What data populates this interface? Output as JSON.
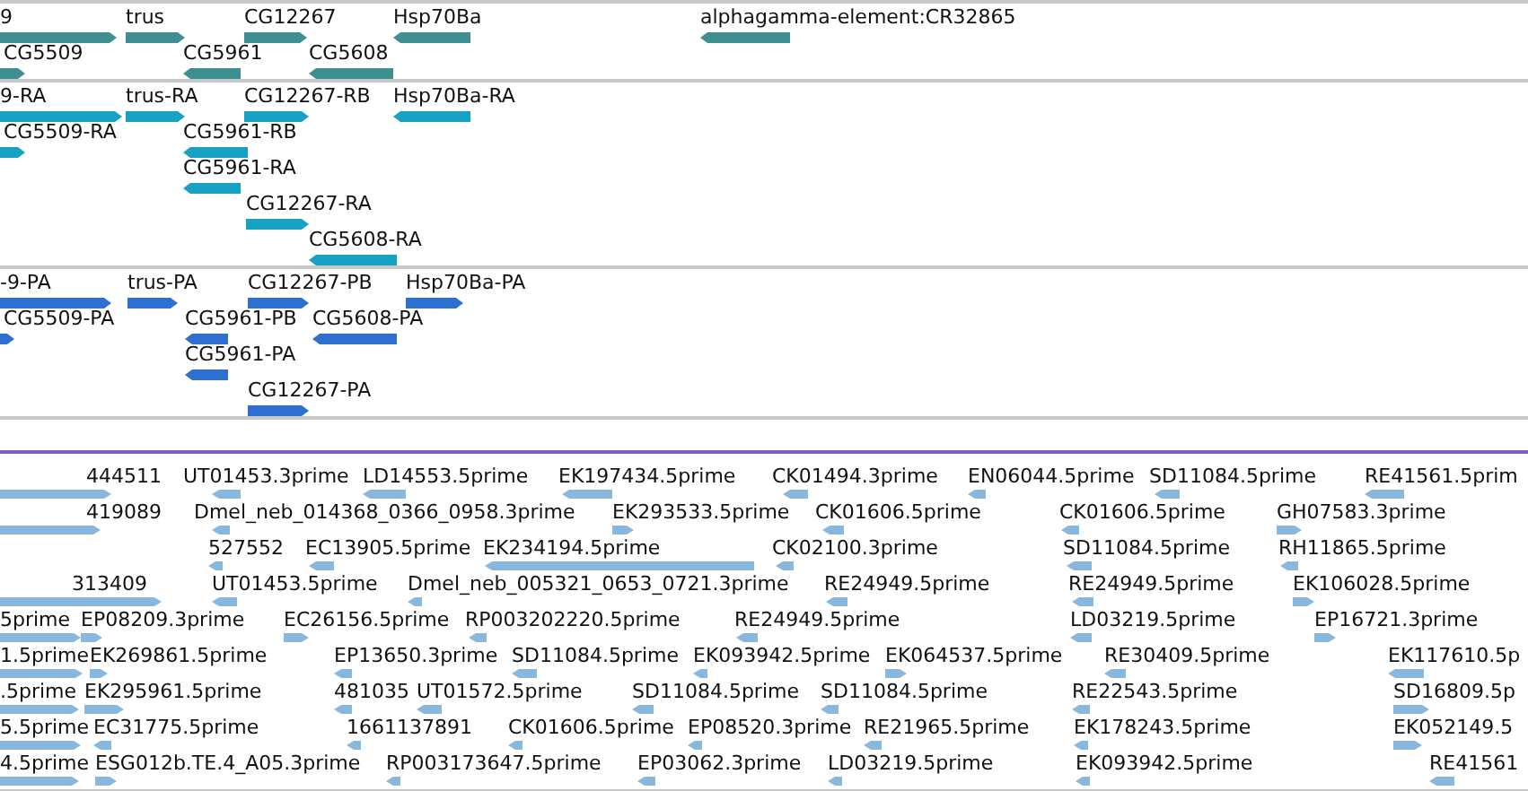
{
  "tracks": [
    {
      "kind": "gene",
      "color": "#3e8e92",
      "lanes": [
        {
          "features": [
            {
              "label": "9",
              "reverse": false
            },
            {
              "label": "trus",
              "reverse": false
            },
            {
              "label": "CG12267",
              "reverse": false
            },
            {
              "label": "Hsp70Ba",
              "reverse": true
            },
            {
              "label": "alphagamma-element:CR32865",
              "reverse": true
            }
          ]
        },
        {
          "features": [
            {
              "label": "CG5509",
              "reverse": false
            },
            {
              "label": "CG5961",
              "reverse": true
            },
            {
              "label": "CG5608",
              "reverse": true
            }
          ]
        }
      ]
    },
    {
      "kind": "gene",
      "color": "#17a2c4",
      "lanes": [
        {
          "features": [
            {
              "label": "9-RA",
              "reverse": false
            },
            {
              "label": "trus-RA",
              "reverse": false
            },
            {
              "label": "CG12267-RB",
              "reverse": false
            },
            {
              "label": "Hsp70Ba-RA",
              "reverse": true
            }
          ]
        },
        {
          "features": [
            {
              "label": "CG5509-RA",
              "reverse": false
            },
            {
              "label": "CG5961-RB",
              "reverse": true
            }
          ]
        },
        {
          "features": [
            {
              "label": "CG5961-RA",
              "reverse": true
            }
          ]
        },
        {
          "features": [
            {
              "label": "CG12267-RA",
              "reverse": false
            }
          ]
        },
        {
          "features": [
            {
              "label": "CG5608-RA",
              "reverse": true
            }
          ]
        }
      ]
    },
    {
      "kind": "gene",
      "color": "#2f6fd0",
      "lanes": [
        {
          "features": [
            {
              "label": "-9-PA",
              "reverse": false
            },
            {
              "label": "trus-PA",
              "reverse": false
            },
            {
              "label": "CG12267-PB",
              "reverse": false
            },
            {
              "label": "Hsp70Ba-PA",
              "reverse": false
            }
          ]
        },
        {
          "features": [
            {
              "label": "CG5509-PA",
              "reverse": false
            },
            {
              "label": "CG5961-PB",
              "reverse": true
            },
            {
              "label": "CG5608-PA",
              "reverse": true
            }
          ]
        },
        {
          "features": [
            {
              "label": "CG5961-PA",
              "reverse": true
            }
          ]
        },
        {
          "features": [
            {
              "label": "CG12267-PA",
              "reverse": false
            }
          ]
        }
      ]
    },
    {
      "kind": "est",
      "color": "#88b8de",
      "lanes": [
        {
          "features": [
            {
              "label": "444511",
              "reverse": false
            },
            {
              "label": "UT01453.3prime",
              "reverse": true
            },
            {
              "label": "LD14553.5prime",
              "reverse": true
            },
            {
              "label": "EK197434.5prime",
              "reverse": true
            },
            {
              "label": "CK01494.3prime",
              "reverse": true
            },
            {
              "label": "EN06044.5prime",
              "reverse": true
            },
            {
              "label": "SD11084.5prime",
              "reverse": true
            },
            {
              "label": "RE41561.5prim",
              "reverse": true
            }
          ]
        },
        {
          "features": [
            {
              "label": "419089",
              "reverse": false
            },
            {
              "label": "Dmel_neb_014368_0366_0958.3prime",
              "reverse": true
            },
            {
              "label": "EK293533.5prime",
              "reverse": false
            },
            {
              "label": "CK01606.5prime",
              "reverse": true
            },
            {
              "label": "CK01606.5prime",
              "reverse": true
            },
            {
              "label": "GH07583.3prime",
              "reverse": false
            }
          ]
        },
        {
          "features": [
            {
              "label": "527552",
              "reverse": true
            },
            {
              "label": "EC13905.5prime",
              "reverse": true
            },
            {
              "label": "EK234194.5prime",
              "reverse": true
            },
            {
              "label": "CK02100.3prime",
              "reverse": true
            },
            {
              "label": "SD11084.5prime",
              "reverse": true
            },
            {
              "label": "RH11865.5prime",
              "reverse": true
            }
          ]
        },
        {
          "features": [
            {
              "label": "313409",
              "reverse": false
            },
            {
              "label": "UT01453.5prime",
              "reverse": true
            },
            {
              "label": "Dmel_neb_005321_0653_0721.3prime",
              "reverse": true
            },
            {
              "label": "RE24949.5prime",
              "reverse": true
            },
            {
              "label": "RE24949.5prime",
              "reverse": true
            },
            {
              "label": "EK106028.5prime",
              "reverse": false
            }
          ]
        },
        {
          "features": [
            {
              "label": "5prime",
              "reverse": false
            },
            {
              "label": "EP08209.3prime",
              "reverse": false
            },
            {
              "label": "EC26156.5prime",
              "reverse": false
            },
            {
              "label": "RP003202220.5prime",
              "reverse": true
            },
            {
              "label": "RE24949.5prime",
              "reverse": true
            },
            {
              "label": "LD03219.5prime",
              "reverse": true
            },
            {
              "label": "EP16721.3prime",
              "reverse": false
            }
          ]
        },
        {
          "features": [
            {
              "label": "1.5prime",
              "reverse": false
            },
            {
              "label": "EK269861.5prime",
              "reverse": false
            },
            {
              "label": "EP13650.3prime",
              "reverse": true
            },
            {
              "label": "SD11084.5prime",
              "reverse": true
            },
            {
              "label": "EK093942.5prime",
              "reverse": true
            },
            {
              "label": "EK064537.5prime",
              "reverse": false
            },
            {
              "label": "RE30409.5prime",
              "reverse": true
            },
            {
              "label": "EK117610.5p",
              "reverse": true
            }
          ]
        },
        {
          "features": [
            {
              "label": ".5prime",
              "reverse": false
            },
            {
              "label": "EK295961.5prime",
              "reverse": false
            },
            {
              "label": "481035",
              "reverse": true
            },
            {
              "label": "UT01572.5prime",
              "reverse": true
            },
            {
              "label": "SD11084.5prime",
              "reverse": true
            },
            {
              "label": "SD11084.5prime",
              "reverse": true
            },
            {
              "label": "RE22543.5prime",
              "reverse": true
            },
            {
              "label": "SD16809.5p",
              "reverse": false
            }
          ]
        },
        {
          "features": [
            {
              "label": "5.5prime",
              "reverse": false
            },
            {
              "label": "EC31775.5prime",
              "reverse": true
            },
            {
              "label": "1661137891",
              "reverse": true
            },
            {
              "label": "CK01606.5prime",
              "reverse": true
            },
            {
              "label": "EP08520.3prime",
              "reverse": true
            },
            {
              "label": "RE21965.5prime",
              "reverse": true
            },
            {
              "label": "EK178243.5prime",
              "reverse": true
            },
            {
              "label": "EK052149.5",
              "reverse": false
            }
          ]
        },
        {
          "features": [
            {
              "label": "4.5prime",
              "reverse": false
            },
            {
              "label": "ESG012b.TE.4_A05.3prime",
              "reverse": false
            },
            {
              "label": "RP003173647.5prime",
              "reverse": true
            },
            {
              "label": "EP03062.3prime",
              "reverse": true
            },
            {
              "label": "LD03219.5prime",
              "reverse": true
            },
            {
              "label": "EK093942.5prime",
              "reverse": true
            },
            {
              "label": "RE41561",
              "reverse": true
            }
          ]
        }
      ]
    }
  ]
}
